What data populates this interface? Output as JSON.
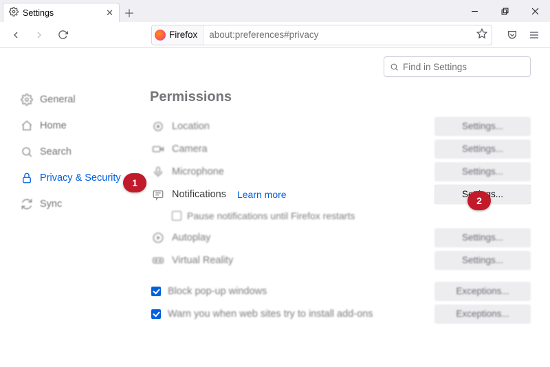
{
  "window": {
    "tab_title": "Settings",
    "min_tip": "Minimize",
    "max_tip": "Restore",
    "close_tip": "Close"
  },
  "toolbar": {
    "identity_label": "Firefox",
    "url": "about:preferences#privacy"
  },
  "search": {
    "placeholder": "Find in Settings"
  },
  "sidebar": {
    "items": [
      {
        "id": "general",
        "label": "General"
      },
      {
        "id": "home",
        "label": "Home"
      },
      {
        "id": "search",
        "label": "Search"
      },
      {
        "id": "privacy",
        "label": "Privacy & Security"
      },
      {
        "id": "sync",
        "label": "Sync"
      }
    ],
    "active": "privacy"
  },
  "main": {
    "section_title": "Permissions",
    "learn_more": "Learn more",
    "settings_btn": "Settings...",
    "exceptions_btn": "Exceptions...",
    "rows": {
      "location": "Location",
      "camera": "Camera",
      "microphone": "Microphone",
      "notifications": "Notifications",
      "pause_notif": "Pause notifications until Firefox restarts",
      "autoplay": "Autoplay",
      "vr": "Virtual Reality",
      "block_popups": "Block pop-up windows",
      "warn_addons": "Warn you when web sites try to install add-ons"
    }
  },
  "annotations": {
    "one": "1",
    "two": "2"
  }
}
